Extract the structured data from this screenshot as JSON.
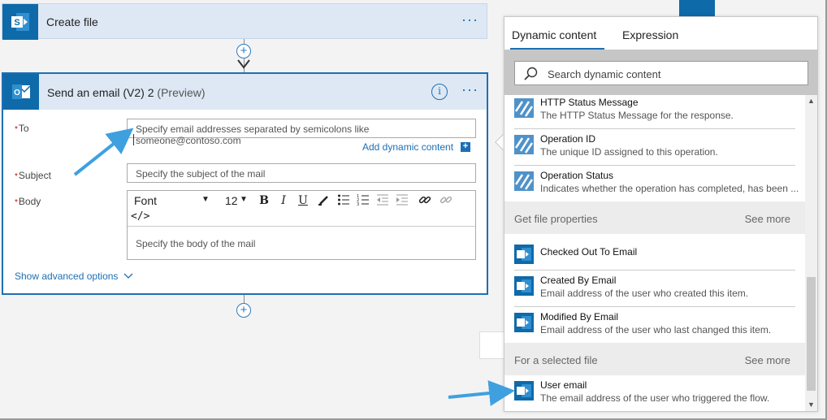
{
  "create_file": {
    "title": "Create file",
    "more": "···"
  },
  "send_email": {
    "title": "Send an email (V2) 2",
    "preview": "(Preview)",
    "info": "i",
    "more": "···",
    "to_label": "To",
    "to_placeholder": "Specify email addresses separated by semicolons like someone@contoso.com",
    "add_dynamic": "Add dynamic content",
    "subject_label": "Subject",
    "subject_placeholder": "Specify the subject of the mail",
    "body_label": "Body",
    "body_placeholder": "Specify the body of the mail",
    "font": "Font",
    "font_size": "12",
    "html_toggle": "</>",
    "show_advanced": "Show advanced options",
    "required_mark": "*"
  },
  "panel": {
    "tabs": [
      "Dynamic content",
      "Expression"
    ],
    "search_placeholder": "Search dynamic content",
    "items_top": [
      {
        "name": "HTTP Status Message",
        "desc": "The HTTP Status Message for the response.",
        "icon": "http-icon"
      },
      {
        "name": "Operation ID",
        "desc": "The unique ID assigned to this operation.",
        "icon": "http-icon"
      },
      {
        "name": "Operation Status",
        "desc": "Indicates whether the operation has completed, has been ...",
        "icon": "http-icon"
      }
    ],
    "section_file": {
      "title": "Get file properties",
      "more": "See more"
    },
    "items_file": [
      {
        "name": "Checked Out To Email",
        "desc": "",
        "icon": "sharepoint-icon"
      },
      {
        "name": "Created By Email",
        "desc": "Email address of the user who created this item.",
        "icon": "sharepoint-icon"
      },
      {
        "name": "Modified By Email",
        "desc": "Email address of the user who last changed this item.",
        "icon": "sharepoint-icon"
      }
    ],
    "section_selected": {
      "title": "For a selected file",
      "more": "See more"
    },
    "items_selected": [
      {
        "name": "User email",
        "desc": "The email address of the user who triggered the flow.",
        "icon": "sharepoint-icon"
      }
    ]
  },
  "colors": {
    "accent": "#1d6fb5",
    "header_bg": "#dde8f4",
    "sharepoint": "#0f6aa9",
    "arrow": "#3fa0e0"
  }
}
